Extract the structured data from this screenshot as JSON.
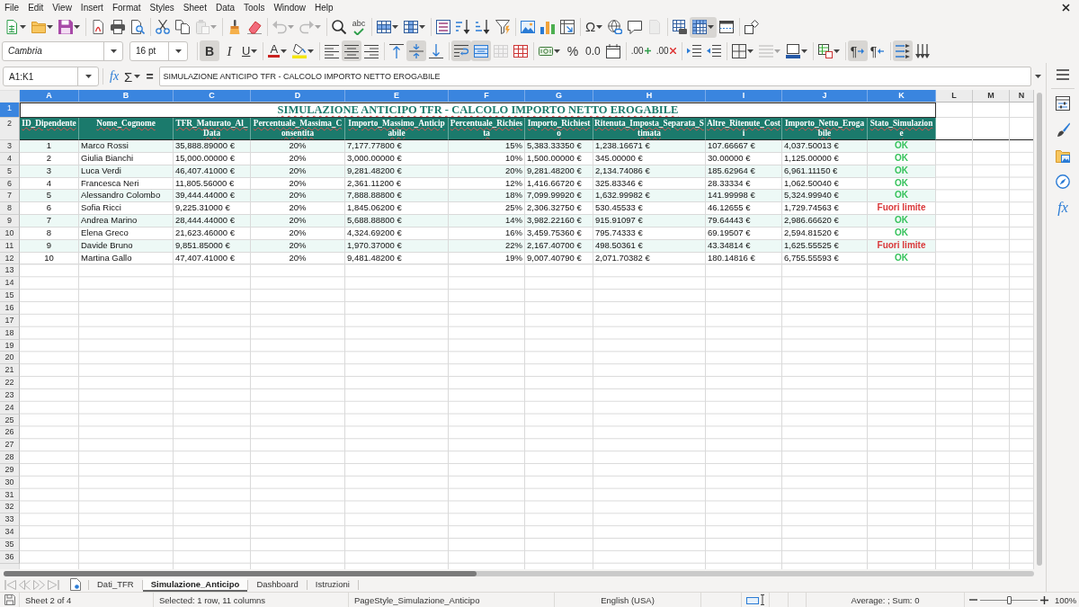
{
  "menu_bar": {
    "items": [
      "File",
      "Edit",
      "View",
      "Insert",
      "Format",
      "Styles",
      "Sheet",
      "Data",
      "Tools",
      "Window",
      "Help"
    ]
  },
  "standard_toolbar": [
    [
      {
        "kind": "new",
        "dropdown": true,
        "on": false,
        "disabled": false
      },
      {
        "kind": "open",
        "dropdown": true,
        "on": false,
        "disabled": false
      },
      {
        "kind": "save",
        "dropdown": true,
        "on": false,
        "disabled": false
      }
    ],
    [
      {
        "kind": "export-pdf",
        "dropdown": false,
        "on": false,
        "disabled": false
      },
      {
        "kind": "print",
        "dropdown": false,
        "on": false,
        "disabled": false
      },
      {
        "kind": "print-preview",
        "dropdown": false,
        "on": false,
        "disabled": false
      }
    ],
    [
      {
        "kind": "cut",
        "dropdown": false,
        "on": false,
        "disabled": false
      },
      {
        "kind": "copy",
        "dropdown": false,
        "on": false,
        "disabled": false
      },
      {
        "kind": "paste",
        "dropdown": true,
        "on": false,
        "disabled": true
      }
    ],
    [
      {
        "kind": "clone-formatting",
        "dropdown": false,
        "on": false,
        "disabled": false
      },
      {
        "kind": "clear-formatting",
        "dropdown": false,
        "on": false,
        "disabled": false
      }
    ],
    [
      {
        "kind": "undo",
        "dropdown": true,
        "on": false,
        "disabled": true
      },
      {
        "kind": "redo",
        "dropdown": true,
        "on": false,
        "disabled": true
      }
    ],
    [
      {
        "kind": "find-replace",
        "dropdown": false,
        "on": false,
        "disabled": false
      },
      {
        "kind": "spelling",
        "glyph": "abc",
        "dropdown": false,
        "on": false,
        "disabled": false
      }
    ],
    [
      {
        "kind": "row",
        "dropdown": true,
        "on": false,
        "disabled": false
      },
      {
        "kind": "column",
        "dropdown": true,
        "on": false,
        "disabled": false
      }
    ],
    [
      {
        "kind": "sort",
        "dropdown": false,
        "on": false,
        "disabled": false
      },
      {
        "kind": "sort-ascending",
        "dropdown": false,
        "on": false,
        "disabled": false
      },
      {
        "kind": "sort-descending",
        "dropdown": false,
        "on": false,
        "disabled": false
      },
      {
        "kind": "autofilter",
        "dropdown": false,
        "on": false,
        "disabled": false
      }
    ],
    [
      {
        "kind": "image",
        "dropdown": false,
        "on": false,
        "disabled": false
      },
      {
        "kind": "chart",
        "dropdown": false,
        "on": false,
        "disabled": false
      },
      {
        "kind": "pivot-table",
        "dropdown": false,
        "on": false,
        "disabled": false
      }
    ],
    [
      {
        "kind": "special-character",
        "glyph": "Ω",
        "dropdown": true,
        "on": false,
        "disabled": false
      },
      {
        "kind": "hyperlink",
        "dropdown": false,
        "on": false,
        "disabled": false
      },
      {
        "kind": "comment",
        "dropdown": false,
        "on": false,
        "disabled": false
      },
      {
        "kind": "header-footer",
        "dropdown": false,
        "on": false,
        "disabled": true
      }
    ],
    [
      {
        "kind": "print-range",
        "dropdown": false,
        "on": false,
        "disabled": false
      },
      {
        "kind": "freeze",
        "dropdown": true,
        "on": true,
        "disabled": false
      },
      {
        "kind": "split-window",
        "dropdown": false,
        "on": false,
        "disabled": false
      }
    ],
    [
      {
        "kind": "draw-functions",
        "dropdown": false,
        "on": false,
        "disabled": false
      }
    ]
  ],
  "formatting_toolbar": {
    "font_name": "Cambria",
    "font_size": "16 pt",
    "buttons": [
      [
        {
          "kind": "bold",
          "glyph": "B",
          "dropdown": false,
          "on": true,
          "disabled": false
        },
        {
          "kind": "italic",
          "glyph": "I",
          "dropdown": false,
          "on": false,
          "disabled": false
        },
        {
          "kind": "underline",
          "glyph": "U",
          "dropdown": true,
          "on": false,
          "disabled": false
        }
      ],
      [
        {
          "kind": "font-color",
          "glyph": "A",
          "dropdown": true,
          "on": false,
          "disabled": false
        },
        {
          "kind": "highlight",
          "dropdown": true,
          "on": false,
          "disabled": false
        }
      ],
      [
        {
          "kind": "align-left",
          "dropdown": false,
          "on": false,
          "disabled": false
        },
        {
          "kind": "align-center",
          "dropdown": false,
          "on": true,
          "disabled": false
        },
        {
          "kind": "align-right",
          "dropdown": false,
          "on": false,
          "disabled": false
        }
      ],
      [
        {
          "kind": "align-top",
          "dropdown": false,
          "on": false,
          "disabled": false
        },
        {
          "kind": "align-middle",
          "dropdown": false,
          "on": true,
          "disabled": false
        },
        {
          "kind": "align-bottom",
          "dropdown": false,
          "on": false,
          "disabled": false
        }
      ],
      [
        {
          "kind": "wrap-text",
          "dropdown": false,
          "on": true,
          "disabled": false
        },
        {
          "kind": "merge-center",
          "dropdown": false,
          "on": true,
          "disabled": false
        },
        {
          "kind": "merge-cells",
          "dropdown": false,
          "on": false,
          "disabled": true
        },
        {
          "kind": "unmerge-cells",
          "dropdown": false,
          "on": false,
          "disabled": false
        }
      ],
      [
        {
          "kind": "currency-format",
          "dropdown": true,
          "on": false,
          "disabled": false
        },
        {
          "kind": "percent",
          "glyph": "%",
          "dropdown": false,
          "on": false,
          "disabled": false
        },
        {
          "kind": "standard-format",
          "glyph": "0.0",
          "dropdown": false,
          "on": false,
          "disabled": false
        },
        {
          "kind": "date-format",
          "dropdown": false,
          "on": false,
          "disabled": false
        }
      ],
      [
        {
          "kind": "add-decimal",
          "glyph": ".00",
          "dropdown": false,
          "on": false,
          "disabled": false
        },
        {
          "kind": "delete-decimal",
          "glyph": ".00",
          "dropdown": false,
          "on": false,
          "disabled": false
        }
      ],
      [
        {
          "kind": "indent",
          "dropdown": false,
          "on": false,
          "disabled": false
        },
        {
          "kind": "outdent",
          "dropdown": false,
          "on": false,
          "disabled": false
        }
      ],
      [
        {
          "kind": "borders",
          "dropdown": true,
          "on": false,
          "disabled": false
        },
        {
          "kind": "border-style",
          "dropdown": true,
          "on": false,
          "disabled": true
        },
        {
          "kind": "border-color",
          "dropdown": true,
          "on": false,
          "disabled": false
        }
      ],
      [
        {
          "kind": "conditional-format",
          "dropdown": true,
          "on": false,
          "disabled": false
        }
      ],
      [
        {
          "kind": "ltr",
          "glyph": "¶",
          "dropdown": false,
          "on": true,
          "disabled": false
        },
        {
          "kind": "rtl",
          "glyph": "¶",
          "dropdown": false,
          "on": false,
          "disabled": false
        }
      ],
      [
        {
          "kind": "text-direction",
          "dropdown": false,
          "on": true,
          "disabled": false
        },
        {
          "kind": "vertical-text",
          "dropdown": false,
          "on": false,
          "disabled": false
        }
      ]
    ]
  },
  "formula_bar": {
    "name_box": "A1:K1",
    "function_wizard": "fx",
    "sum": "Σ",
    "formula": "=",
    "content": "SIMULAZIONE ANTICIPO TFR - CALCOLO IMPORTO NETTO EROGABILE"
  },
  "sheet": {
    "columns": [
      {
        "label": "A",
        "selected": true
      },
      {
        "label": "B",
        "selected": true
      },
      {
        "label": "C",
        "selected": true
      },
      {
        "label": "D",
        "selected": true
      },
      {
        "label": "E",
        "selected": true
      },
      {
        "label": "F",
        "selected": true
      },
      {
        "label": "G",
        "selected": true
      },
      {
        "label": "H",
        "selected": true
      },
      {
        "label": "I",
        "selected": true
      },
      {
        "label": "J",
        "selected": true
      },
      {
        "label": "K",
        "selected": true
      },
      {
        "label": "L",
        "selected": false
      },
      {
        "label": "M",
        "selected": false
      },
      {
        "label": "N",
        "selected": false
      }
    ],
    "rows": [
      {
        "label": "1",
        "selected": true
      },
      {
        "label": "2",
        "selected": false
      },
      {
        "label": "3",
        "selected": false
      },
      {
        "label": "4",
        "selected": false
      },
      {
        "label": "5",
        "selected": false
      },
      {
        "label": "6",
        "selected": false
      },
      {
        "label": "7",
        "selected": false
      },
      {
        "label": "8",
        "selected": false
      },
      {
        "label": "9",
        "selected": false
      },
      {
        "label": "10",
        "selected": false
      },
      {
        "label": "11",
        "selected": false
      },
      {
        "label": "12",
        "selected": false
      },
      {
        "label": "13",
        "selected": false
      },
      {
        "label": "14",
        "selected": false
      },
      {
        "label": "15",
        "selected": false
      },
      {
        "label": "16",
        "selected": false
      },
      {
        "label": "17",
        "selected": false
      },
      {
        "label": "18",
        "selected": false
      },
      {
        "label": "19",
        "selected": false
      },
      {
        "label": "20",
        "selected": false
      },
      {
        "label": "21",
        "selected": false
      },
      {
        "label": "22",
        "selected": false
      },
      {
        "label": "23",
        "selected": false
      },
      {
        "label": "24",
        "selected": false
      },
      {
        "label": "25",
        "selected": false
      },
      {
        "label": "26",
        "selected": false
      },
      {
        "label": "27",
        "selected": false
      },
      {
        "label": "28",
        "selected": false
      },
      {
        "label": "29",
        "selected": false
      },
      {
        "label": "30",
        "selected": false
      },
      {
        "label": "31",
        "selected": false
      },
      {
        "label": "32",
        "selected": false
      },
      {
        "label": "33",
        "selected": false
      },
      {
        "label": "34",
        "selected": false
      },
      {
        "label": "35",
        "selected": false
      },
      {
        "label": "36",
        "selected": false
      }
    ],
    "title": "SIMULAZIONE ANTICIPO TFR - CALCOLO IMPORTO NETTO EROGABILE",
    "headers": [
      "ID_Dipendente",
      "Nome_Cognome",
      "TFR_Maturato_Al_Data",
      "Percentuale_Massima_Consentita",
      "Importo_Massimo_Anticipabile",
      "Percentuale_Richiesta",
      "Importo_Richiesto",
      "Ritenuta_Imposta_Separata_Stimata",
      "Altre_Ritenute_Costi",
      "Importo_Netto_Erogabile",
      "Stato_Simulazione"
    ],
    "records": [
      {
        "cells": [
          "1",
          "Marco Rossi",
          "35,888.89000 €",
          "20%",
          "7,177.77800 €",
          "15%",
          "5,383.33350 €",
          "1,238.16671 €",
          "107.66667 €",
          "4,037.50013 €"
        ],
        "status": {
          "text": "OK",
          "color": "#35c25b"
        }
      },
      {
        "cells": [
          "2",
          "Giulia Bianchi",
          "15,000.00000 €",
          "20%",
          "3,000.00000 €",
          "10%",
          "1,500.00000 €",
          "345.00000 €",
          "30.00000 €",
          "1,125.00000 €"
        ],
        "status": {
          "text": "OK",
          "color": "#35c25b"
        }
      },
      {
        "cells": [
          "3",
          "Luca Verdi",
          "46,407.41000 €",
          "20%",
          "9,281.48200 €",
          "20%",
          "9,281.48200 €",
          "2,134.74086 €",
          "185.62964 €",
          "6,961.11150 €"
        ],
        "status": {
          "text": "OK",
          "color": "#35c25b"
        }
      },
      {
        "cells": [
          "4",
          "Francesca Neri",
          "11,805.56000 €",
          "20%",
          "2,361.11200 €",
          "12%",
          "1,416.66720 €",
          "325.83346 €",
          "28.33334 €",
          "1,062.50040 €"
        ],
        "status": {
          "text": "OK",
          "color": "#35c25b"
        }
      },
      {
        "cells": [
          "5",
          "Alessandro Colombo",
          "39,444.44000 €",
          "20%",
          "7,888.88800 €",
          "18%",
          "7,099.99920 €",
          "1,632.99982 €",
          "141.99998 €",
          "5,324.99940 €"
        ],
        "status": {
          "text": "OK",
          "color": "#35c25b"
        }
      },
      {
        "cells": [
          "6",
          "Sofia Ricci",
          "9,225.31000 €",
          "20%",
          "1,845.06200 €",
          "25%",
          "2,306.32750 €",
          "530.45533 €",
          "46.12655 €",
          "1,729.74563 €"
        ],
        "status": {
          "text": "Fuori limite",
          "color": "#d9383a"
        }
      },
      {
        "cells": [
          "7",
          "Andrea Marino",
          "28,444.44000 €",
          "20%",
          "5,688.88800 €",
          "14%",
          "3,982.22160 €",
          "915.91097 €",
          "79.64443 €",
          "2,986.66620 €"
        ],
        "status": {
          "text": "OK",
          "color": "#35c25b"
        }
      },
      {
        "cells": [
          "8",
          "Elena Greco",
          "21,623.46000 €",
          "20%",
          "4,324.69200 €",
          "16%",
          "3,459.75360 €",
          "795.74333 €",
          "69.19507 €",
          "2,594.81520 €"
        ],
        "status": {
          "text": "OK",
          "color": "#35c25b"
        }
      },
      {
        "cells": [
          "9",
          "Davide Bruno",
          "9,851.85000 €",
          "20%",
          "1,970.37000 €",
          "22%",
          "2,167.40700 €",
          "498.50361 €",
          "43.34814 €",
          "1,625.55525 €"
        ],
        "status": {
          "text": "Fuori limite",
          "color": "#d9383a"
        }
      },
      {
        "cells": [
          "10",
          "Martina Gallo",
          "47,407.41000 €",
          "20%",
          "9,481.48200 €",
          "19%",
          "9,007.40790 €",
          "2,071.70382 €",
          "180.14816 €",
          "6,755.55593 €"
        ],
        "status": {
          "text": "OK",
          "color": "#35c25b"
        }
      }
    ]
  },
  "sidebar": {
    "items": [
      {
        "kind": "properties",
        "selected": false
      },
      {
        "kind": "styles",
        "selected": false
      },
      {
        "kind": "gallery",
        "selected": false
      },
      {
        "kind": "navigator",
        "selected": false
      },
      {
        "kind": "functions",
        "glyph": "fx",
        "selected": false
      }
    ]
  },
  "sheet_tabs": {
    "navigation": [
      {
        "kind": "first",
        "disabled": true
      },
      {
        "kind": "previous",
        "disabled": true
      },
      {
        "kind": "next",
        "disabled": true
      },
      {
        "kind": "last",
        "disabled": true
      }
    ],
    "tabs": [
      {
        "label": "Dati_TFR",
        "selected": false
      },
      {
        "label": "Simulazione_Anticipo",
        "selected": true
      },
      {
        "label": "Dashboard",
        "selected": false
      },
      {
        "label": "Istruzioni",
        "selected": false
      }
    ]
  },
  "status_bar": {
    "sheet": "Sheet 2 of 4",
    "selection": "Selected: 1 row, 11 columns",
    "page_style": "PageStyle_Simulazione_Anticipo",
    "language": "English (USA)",
    "summary": "Average: ; Sum: 0",
    "zoom": {
      "level": 0.5,
      "reading": "100%"
    }
  }
}
